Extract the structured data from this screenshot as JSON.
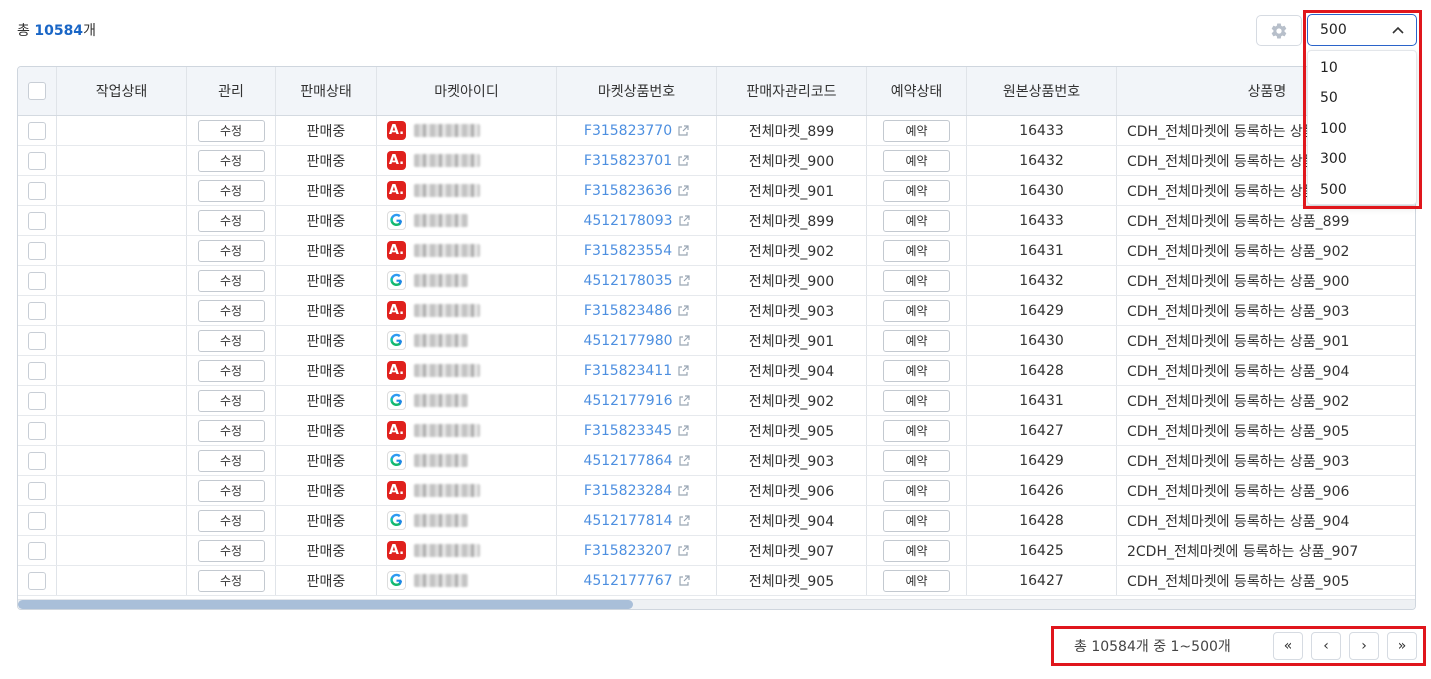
{
  "summary": {
    "prefix": "총 ",
    "count": "10584",
    "suffix": "개"
  },
  "page_size": {
    "selected": "500",
    "options": [
      "10",
      "50",
      "100",
      "300",
      "500"
    ]
  },
  "columns": [
    "작업상태",
    "관리",
    "판매상태",
    "마켓아이디",
    "마켓상품번호",
    "판매자관리코드",
    "예약상태",
    "원본상품번호",
    "상품명"
  ],
  "rows": [
    {
      "work": "",
      "manage": "수정",
      "sale": "판매중",
      "market": "A",
      "mpno": "F315823770",
      "code": "전체마켓_899",
      "resv": "예약",
      "orig": "16433",
      "name": "CDH_전체마켓에 등록하는 상품_899"
    },
    {
      "work": "",
      "manage": "수정",
      "sale": "판매중",
      "market": "A",
      "mpno": "F315823701",
      "code": "전체마켓_900",
      "resv": "예약",
      "orig": "16432",
      "name": "CDH_전체마켓에 등록하는 상품_900"
    },
    {
      "work": "",
      "manage": "수정",
      "sale": "판매중",
      "market": "A",
      "mpno": "F315823636",
      "code": "전체마켓_901",
      "resv": "예약",
      "orig": "16430",
      "name": "CDH_전체마켓에 등록하는 상품_901"
    },
    {
      "work": "",
      "manage": "수정",
      "sale": "판매중",
      "market": "G",
      "mpno": "4512178093",
      "code": "전체마켓_899",
      "resv": "예약",
      "orig": "16433",
      "name": "CDH_전체마켓에 등록하는 상품_899"
    },
    {
      "work": "",
      "manage": "수정",
      "sale": "판매중",
      "market": "A",
      "mpno": "F315823554",
      "code": "전체마켓_902",
      "resv": "예약",
      "orig": "16431",
      "name": "CDH_전체마켓에 등록하는 상품_902"
    },
    {
      "work": "",
      "manage": "수정",
      "sale": "판매중",
      "market": "G",
      "mpno": "4512178035",
      "code": "전체마켓_900",
      "resv": "예약",
      "orig": "16432",
      "name": "CDH_전체마켓에 등록하는 상품_900"
    },
    {
      "work": "",
      "manage": "수정",
      "sale": "판매중",
      "market": "A",
      "mpno": "F315823486",
      "code": "전체마켓_903",
      "resv": "예약",
      "orig": "16429",
      "name": "CDH_전체마켓에 등록하는 상품_903"
    },
    {
      "work": "",
      "manage": "수정",
      "sale": "판매중",
      "market": "G",
      "mpno": "4512177980",
      "code": "전체마켓_901",
      "resv": "예약",
      "orig": "16430",
      "name": "CDH_전체마켓에 등록하는 상품_901"
    },
    {
      "work": "",
      "manage": "수정",
      "sale": "판매중",
      "market": "A",
      "mpno": "F315823411",
      "code": "전체마켓_904",
      "resv": "예약",
      "orig": "16428",
      "name": "CDH_전체마켓에 등록하는 상품_904"
    },
    {
      "work": "",
      "manage": "수정",
      "sale": "판매중",
      "market": "G",
      "mpno": "4512177916",
      "code": "전체마켓_902",
      "resv": "예약",
      "orig": "16431",
      "name": "CDH_전체마켓에 등록하는 상품_902"
    },
    {
      "work": "",
      "manage": "수정",
      "sale": "판매중",
      "market": "A",
      "mpno": "F315823345",
      "code": "전체마켓_905",
      "resv": "예약",
      "orig": "16427",
      "name": "CDH_전체마켓에 등록하는 상품_905"
    },
    {
      "work": "",
      "manage": "수정",
      "sale": "판매중",
      "market": "G",
      "mpno": "4512177864",
      "code": "전체마켓_903",
      "resv": "예약",
      "orig": "16429",
      "name": "CDH_전체마켓에 등록하는 상품_903"
    },
    {
      "work": "",
      "manage": "수정",
      "sale": "판매중",
      "market": "A",
      "mpno": "F315823284",
      "code": "전체마켓_906",
      "resv": "예약",
      "orig": "16426",
      "name": "CDH_전체마켓에 등록하는 상품_906"
    },
    {
      "work": "",
      "manage": "수정",
      "sale": "판매중",
      "market": "G",
      "mpno": "4512177814",
      "code": "전체마켓_904",
      "resv": "예약",
      "orig": "16428",
      "name": "CDH_전체마켓에 등록하는 상품_904"
    },
    {
      "work": "",
      "manage": "수정",
      "sale": "판매중",
      "market": "A",
      "mpno": "F315823207",
      "code": "전체마켓_907",
      "resv": "예약",
      "orig": "16425",
      "name": "2CDH_전체마켓에 등록하는 상품_907"
    },
    {
      "work": "",
      "manage": "수정",
      "sale": "판매중",
      "market": "G",
      "mpno": "4512177767",
      "code": "전체마켓_905",
      "resv": "예약",
      "orig": "16427",
      "name": "CDH_전체마켓에 등록하는 상품_905"
    }
  ],
  "pagination": {
    "info": "총 10584개 중 1~500개",
    "first": "«",
    "prev": "‹",
    "next": "›",
    "last": "»"
  },
  "icons": {
    "settings": "gear-icon",
    "dropdown": "chevron-up-icon",
    "external_link": "external-link-icon",
    "market_a": "auction-logo-icon",
    "market_g": "gmarket-logo-icon"
  },
  "colors": {
    "accent": "#1a66c6",
    "link": "#4d8fe0",
    "highlight": "#e0161c",
    "market_a": "#e0211e"
  }
}
